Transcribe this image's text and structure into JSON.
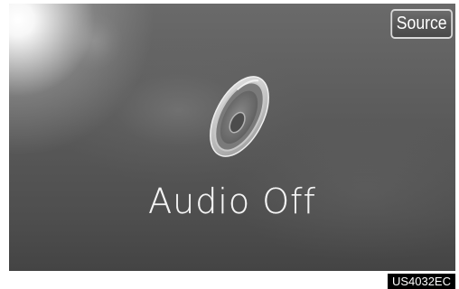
{
  "screen": {
    "source_button_label": "Source",
    "status_text": "Audio Off",
    "speaker_icon": "speaker-icon"
  },
  "image_code": "US4032EC",
  "colors": {
    "background": "#5a5a5a",
    "text": "#f4f4f4",
    "button_border": "#d8d8d8"
  }
}
